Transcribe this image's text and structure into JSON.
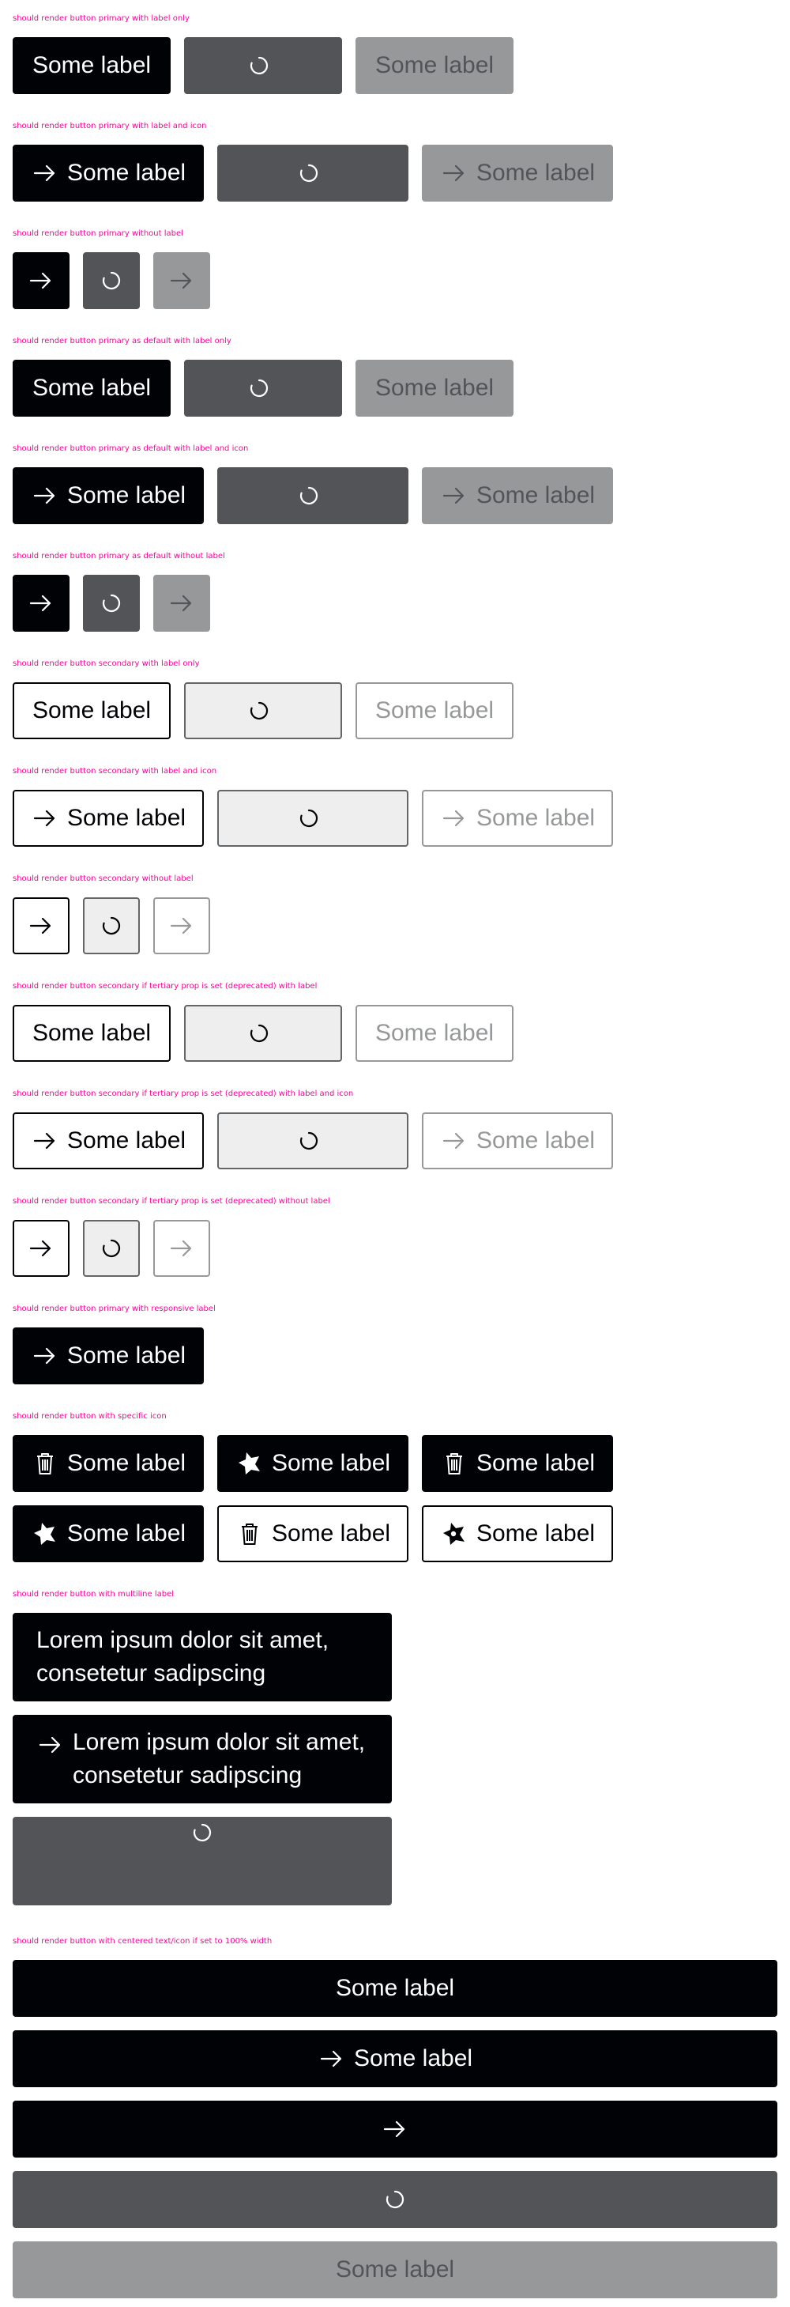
{
  "headings": {
    "h1": "should render button primary with label only",
    "h2": "should render button primary with label and icon",
    "h3": "should render button primary without label",
    "h4": "should render button primary as default with label only",
    "h5": "should render button primary as default with label and icon",
    "h6": "should render button primary as default without label",
    "h7": "should render button secondary with label only",
    "h8": "should render button secondary with label and icon",
    "h9": "should render button secondary without label",
    "h10": "should render button secondary if tertiary prop is set (deprecated) with label",
    "h11": "should render button secondary if tertiary prop is set (deprecated) with label and icon",
    "h12": "should render button secondary if tertiary prop is set (deprecated) without label",
    "h13": "should render button primary with responsive label",
    "h14": "should render button with specific icon",
    "h15": "should render button with multiline label",
    "h16": "should render button with centered text/icon if set to 100% width"
  },
  "labels": {
    "some_label": "Some label",
    "multiline": "Lorem ipsum dolor sit amet, consetetur sadipscing"
  },
  "icons": {
    "arrow": "arrow-right-icon",
    "spinner": "spinner-icon",
    "delete": "delete-icon",
    "highway": "highway-icon"
  },
  "colors": {
    "heading": "#ff0099",
    "primary": "#010205",
    "primary_loading": "#535457",
    "primary_disabled": "#96989a",
    "secondary_loading_bg": "#eeeeee",
    "white": "#ffffff"
  }
}
